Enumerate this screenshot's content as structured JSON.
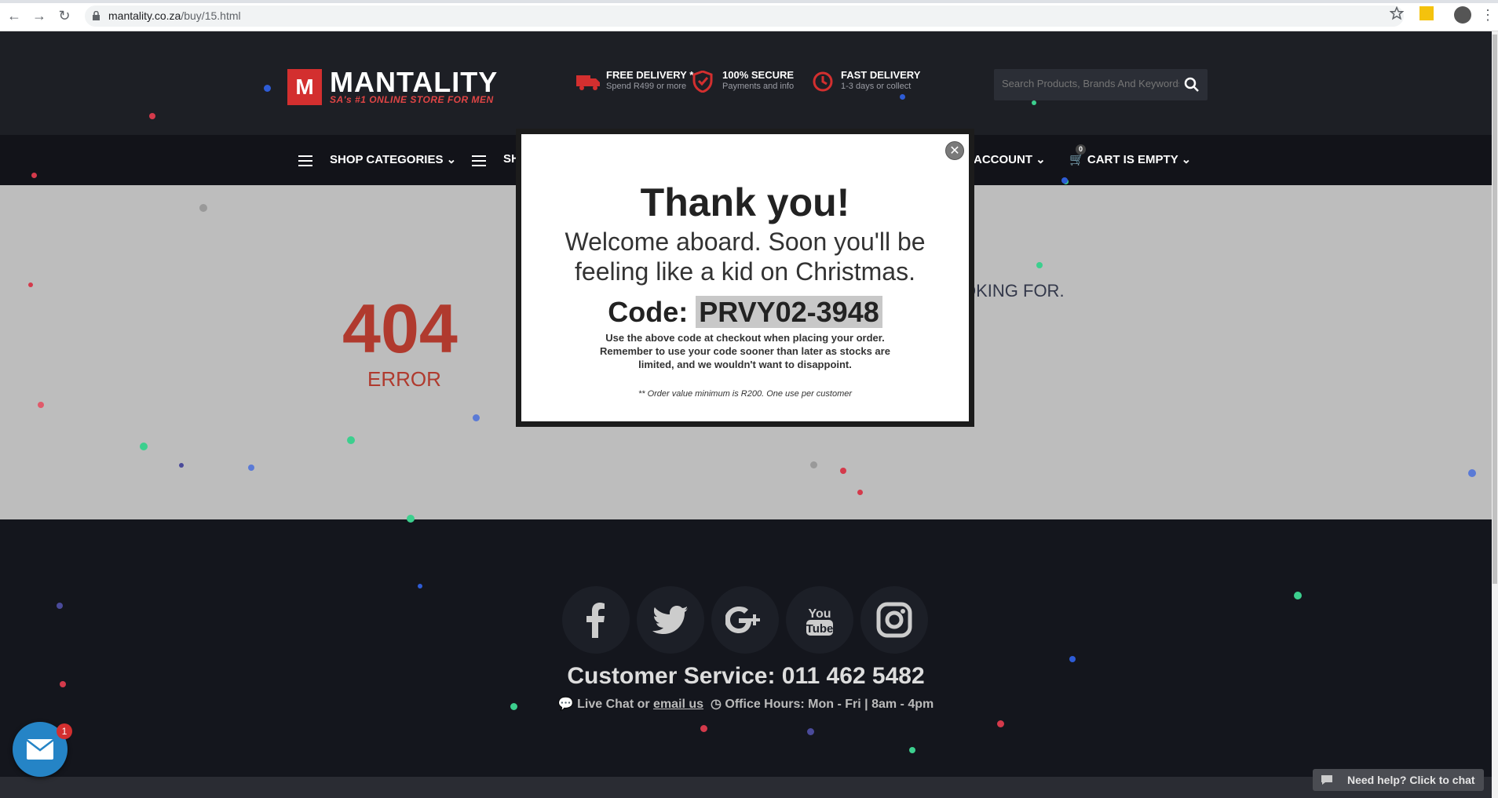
{
  "browser": {
    "url_domain": "mantality.co.za",
    "url_path": "/buy/15.html"
  },
  "header": {
    "logo_letter": "M",
    "logo_name": "MANTALITY",
    "logo_tagline": "SA's #1 ONLINE STORE FOR MEN",
    "features": [
      {
        "title": "FREE DELIVERY *",
        "sub": "Spend R499 or more",
        "icon": "truck-icon"
      },
      {
        "title": "100% SECURE",
        "sub": "Payments and info",
        "icon": "shield-icon"
      },
      {
        "title": "FAST DELIVERY",
        "sub": "1-3 days or collect",
        "icon": "clock-icon"
      }
    ],
    "search_placeholder": "Search Products, Brands And Keywords"
  },
  "nav": {
    "shop_categories": "SHOP CATEGORIES",
    "shop_partial": "SH",
    "account": "ACCOUNT",
    "cart": "CART IS EMPTY",
    "cart_count": "0"
  },
  "main": {
    "code404": "404",
    "error_label": "ERROR",
    "looking_for": "OKING FOR."
  },
  "modal": {
    "title": "Thank you!",
    "subtitle": "Welcome aboard. Soon you'll be feeling like a kid on Christmas.",
    "code_label": "Code:",
    "code_value": "PRVY02-3948",
    "body": "Use the above code at checkout when placing your order. Remember to use your code sooner than later as stocks are limited, and we wouldn't want to disappoint.",
    "note": "** Order value minimum is R200. One use per customer"
  },
  "footer": {
    "social": [
      "facebook-icon",
      "twitter-icon",
      "google-plus-icon",
      "youtube-icon",
      "instagram-icon"
    ],
    "customer_service": "Customer Service: 011 462 5482",
    "live_chat": "Live Chat or",
    "email_link": "email us",
    "office_hours": "Office Hours: Mon - Fri | 8am - 4pm"
  },
  "chat": {
    "badge": "1",
    "need_help": "Need help? Click to chat"
  }
}
